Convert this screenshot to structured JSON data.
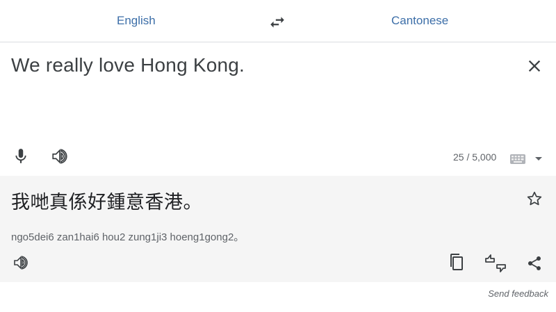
{
  "language_bar": {
    "source_language": "English",
    "target_language": "Cantonese",
    "swap_icon": "swap-horiz-icon"
  },
  "source": {
    "text": "We really love Hong Kong.",
    "char_count": "25 / 5,000",
    "icons": [
      "close-icon",
      "microphone-icon",
      "speaker-icon",
      "keyboard-icon",
      "dropdown-arrow-icon"
    ]
  },
  "translation": {
    "text": "我哋真係好鍾意香港。",
    "romanization": "ngo5dei6 zan1hai6 hou2 zung1ji3 hoeng1gong2。",
    "icons": [
      "star-icon",
      "speaker-icon",
      "copy-icon",
      "rate-thumbs-icon",
      "share-icon"
    ]
  },
  "footer": {
    "feedback_label": "Send feedback"
  },
  "colors": {
    "accent_blue": "#3c6ea8",
    "icon_gray": "#3c4043",
    "translation_bg": "#f5f5f5",
    "divider": "#dadce0"
  }
}
